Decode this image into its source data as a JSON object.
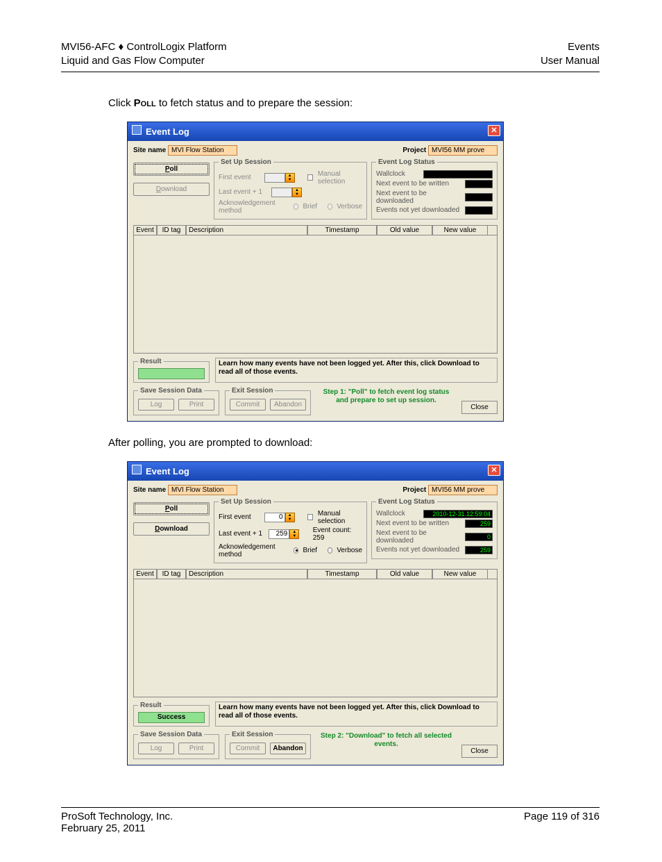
{
  "header": {
    "left1": "MVI56-AFC ♦ ControlLogix Platform",
    "left2": "Liquid and Gas Flow Computer",
    "right1": "Events",
    "right2": "User Manual"
  },
  "intro1_pre": "Click ",
  "intro1_bold": "Poll",
  "intro1_post": " to fetch status and to prepare the session:",
  "intro2": "After polling, you are prompted to download:",
  "footer": {
    "company": "ProSoft Technology, Inc.",
    "date": "February 25, 2011",
    "page": "Page 119 of 316"
  },
  "win_title": "Event Log",
  "labels": {
    "site_name": "Site name",
    "project": "Project",
    "poll": "Poll",
    "download": "Download",
    "setup": "Set Up Session",
    "first_event": "First event",
    "last_event": "Last event + 1",
    "manual_sel": "Manual selection",
    "event_count_pre": "Event count: ",
    "ack_method": "Acknowledgement method",
    "brief": "Brief",
    "verbose": "Verbose",
    "status_title": "Event Log Status",
    "wallclock": "Wallclock",
    "next_write": "Next event to be written",
    "next_dl": "Next event to be downloaded",
    "not_yet": "Events not yet downloaded",
    "result": "Result",
    "success": "Success",
    "save_session": "Save Session Data",
    "log": "Log",
    "print": "Print",
    "exit_session": "Exit Session",
    "commit": "Commit",
    "abandon": "Abandon",
    "close": "Close",
    "learn": "Learn how many events have not been logged yet.  After this, click Download to read all of those events."
  },
  "table_headers": {
    "event": "Event",
    "id": "ID tag",
    "desc": "Description",
    "ts": "Timestamp",
    "old": "Old value",
    "new": "New value"
  },
  "screenshots": [
    {
      "site_value": "MVI Flow Station",
      "project_value": "MVI56 MM prove",
      "poll_bold": true,
      "poll_focused": true,
      "download_bold": false,
      "download_disabled": true,
      "first_event": "",
      "last_event": "",
      "setup_disabled": true,
      "ack_checked": "",
      "event_count": "",
      "status": {
        "wallclock": "",
        "next_write": "",
        "next_dl": "",
        "not_yet": ""
      },
      "result_value": "",
      "log_disabled": true,
      "print_disabled": true,
      "commit_disabled": true,
      "abandon_disabled": true,
      "step_text": "Step 1: \"Poll\" to fetch event log status and prepare to set up session."
    },
    {
      "site_value": "MVI Flow Station",
      "project_value": "MVI56 MM prove",
      "poll_bold": true,
      "poll_focused": true,
      "download_bold": true,
      "download_disabled": false,
      "first_event": "0",
      "last_event": "259",
      "setup_disabled": false,
      "ack_checked": "brief",
      "event_count": "259",
      "status": {
        "wallclock": "2010-12-31.12:59:04",
        "next_write": "259",
        "next_dl": "0",
        "not_yet": "259"
      },
      "result_value": "Success",
      "log_disabled": true,
      "print_disabled": true,
      "commit_disabled": true,
      "abandon_disabled": false,
      "step_text": "Step 2: \"Download\" to fetch all selected events."
    }
  ]
}
